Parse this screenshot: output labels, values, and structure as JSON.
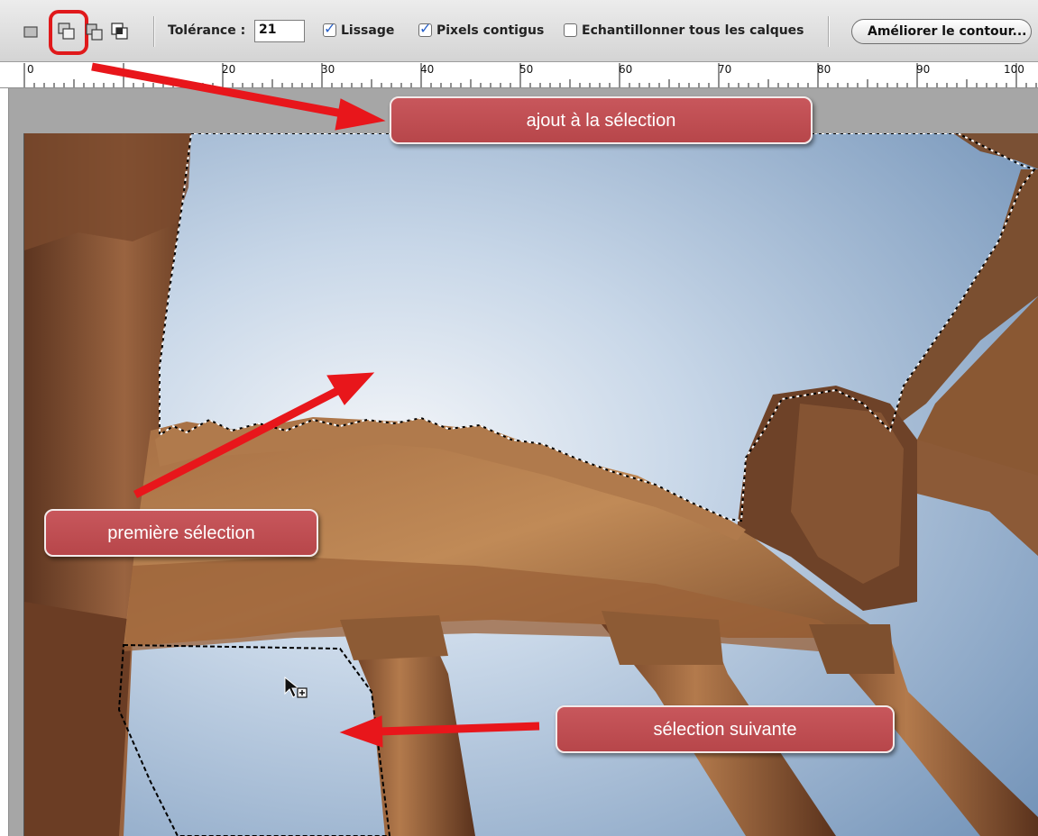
{
  "toolbar": {
    "selection_modes": [
      {
        "name": "new-selection",
        "active": false
      },
      {
        "name": "add-to-selection",
        "active": true
      },
      {
        "name": "subtract-from-selection",
        "active": false
      },
      {
        "name": "intersect-with-selection",
        "active": false
      }
    ],
    "tolerance_label": "Tolérance :",
    "tolerance_value": "21",
    "lissage_label": "Lissage",
    "lissage_checked": true,
    "contigus_label": "Pixels contigus",
    "contigus_checked": true,
    "echantillonner_label": "Echantillonner tous les calques",
    "echantillonner_checked": false,
    "ameliorer_label": "Améliorer le contour...",
    "highlight_color": "#e0191b"
  },
  "ruler": {
    "labels": [
      "0",
      "20",
      "30",
      "40",
      "50",
      "60",
      "70",
      "80",
      "90",
      "100"
    ]
  },
  "callouts": {
    "ajout": "ajout à la sélection",
    "premiere": "première sélection",
    "suivante": "sélection suivante",
    "color": "#c04f54",
    "arrow_color": "#e8161b"
  },
  "icons": {
    "cursor": "magic-wand-add-cursor-icon",
    "arrows": "red-arrow-icon"
  }
}
